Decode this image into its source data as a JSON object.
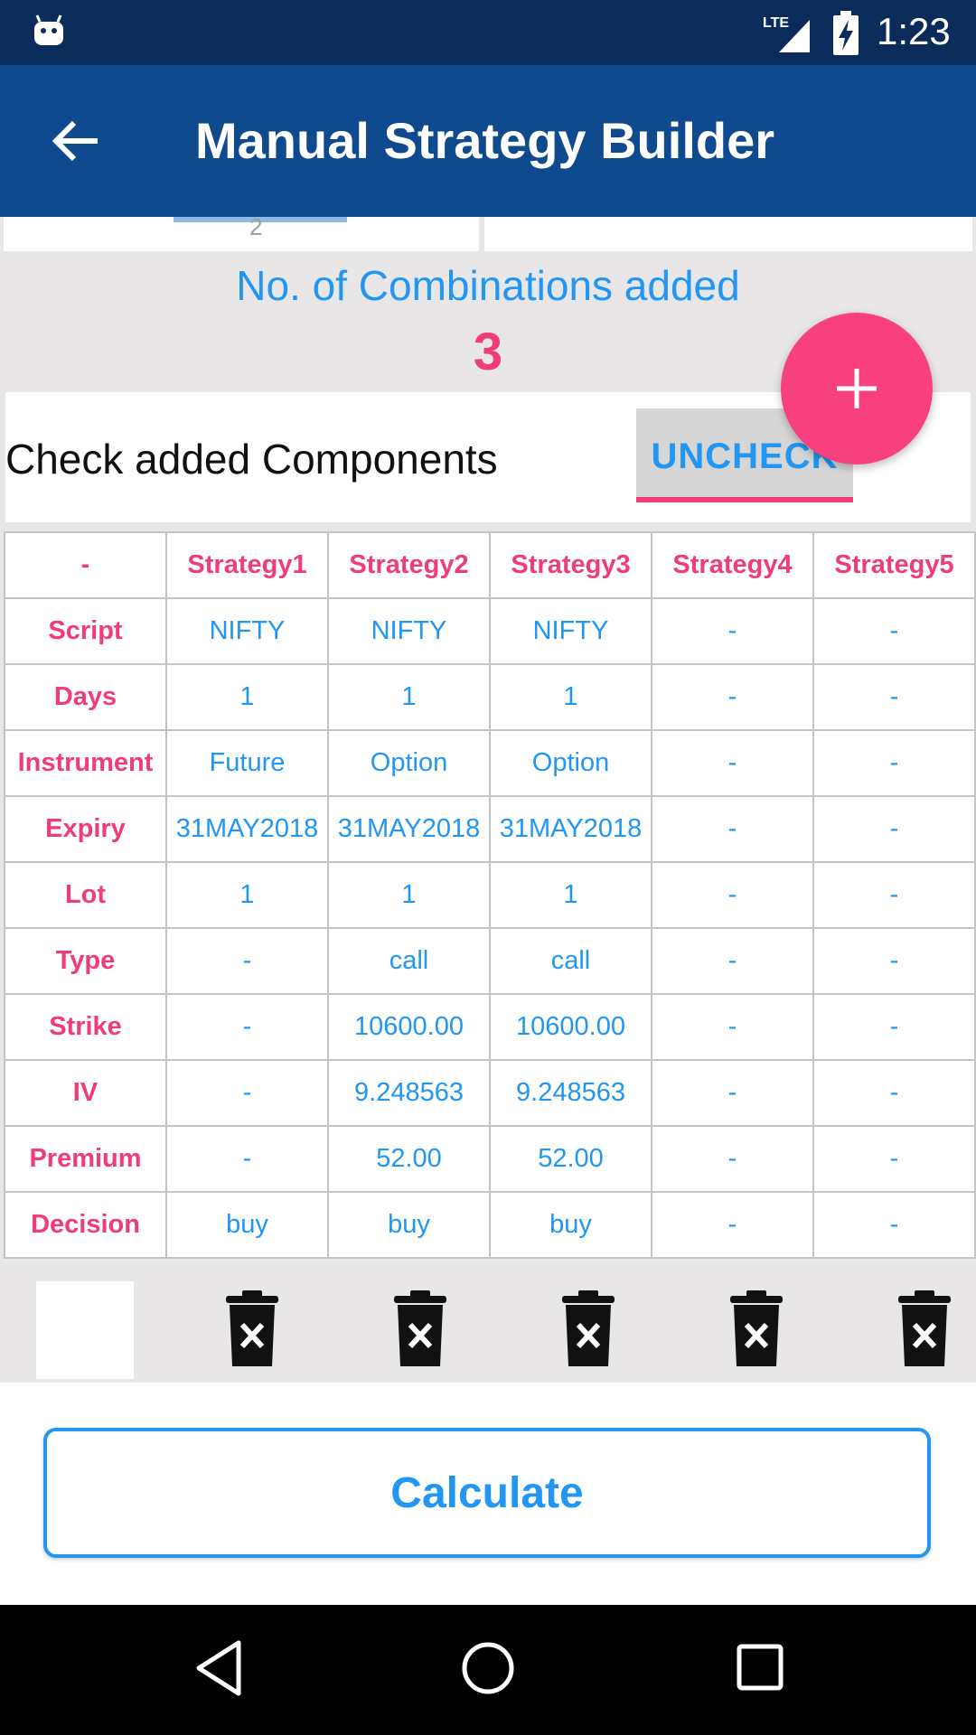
{
  "status_bar": {
    "time": "1:23",
    "network": "LTE",
    "icons": [
      "android-icon",
      "lte-signal-icon",
      "battery-charging-icon"
    ]
  },
  "app_bar": {
    "title": "Manual Strategy Builder",
    "back_icon": "arrow-left-icon"
  },
  "summary": {
    "partial_tab_digit": "2",
    "combinations_label": "No. of Combinations added",
    "combinations_count": "3"
  },
  "components": {
    "label": "Check added Components",
    "uncheck_label": "UNCHECK",
    "add_icon": "plus-icon"
  },
  "table": {
    "headers": [
      "-",
      "Strategy1",
      "Strategy2",
      "Strategy3",
      "Strategy4",
      "Strategy5"
    ],
    "rows": [
      {
        "label": "Script",
        "values": [
          "NIFTY",
          "NIFTY",
          "NIFTY",
          "-",
          "-"
        ]
      },
      {
        "label": "Days",
        "values": [
          "1",
          "1",
          "1",
          "-",
          "-"
        ]
      },
      {
        "label": "Instrument",
        "values": [
          "Future",
          "Option",
          "Option",
          "-",
          "-"
        ]
      },
      {
        "label": "Expiry",
        "values": [
          "31MAY2018",
          "31MAY2018",
          "31MAY2018",
          "-",
          "-"
        ]
      },
      {
        "label": "Lot",
        "values": [
          "1",
          "1",
          "1",
          "-",
          "-"
        ]
      },
      {
        "label": "Type",
        "values": [
          "-",
          "call",
          "call",
          "-",
          "-"
        ]
      },
      {
        "label": "Strike",
        "values": [
          "-",
          "10600.00",
          "10600.00",
          "-",
          "-"
        ]
      },
      {
        "label": "IV",
        "values": [
          "-",
          "9.248563",
          "9.248563",
          "-",
          "-"
        ]
      },
      {
        "label": "Premium",
        "values": [
          "-",
          "52.00",
          "52.00",
          "-",
          "-"
        ]
      },
      {
        "label": "Decision",
        "values": [
          "buy",
          "buy",
          "buy",
          "-",
          "-"
        ]
      }
    ]
  },
  "delete_icons": [
    "trash-icon",
    "trash-icon",
    "trash-icon",
    "trash-icon",
    "trash-icon"
  ],
  "calculate_label": "Calculate",
  "nav_bar": {
    "icons": [
      "back-triangle-icon",
      "home-circle-icon",
      "recents-square-icon"
    ]
  },
  "colors": {
    "status_bar": "#0b2c5b",
    "app_bar": "#0f4a8f",
    "accent_pink": "#f03c7a",
    "accent_blue": "#2196f3",
    "background_gray": "#e8e6e7"
  }
}
